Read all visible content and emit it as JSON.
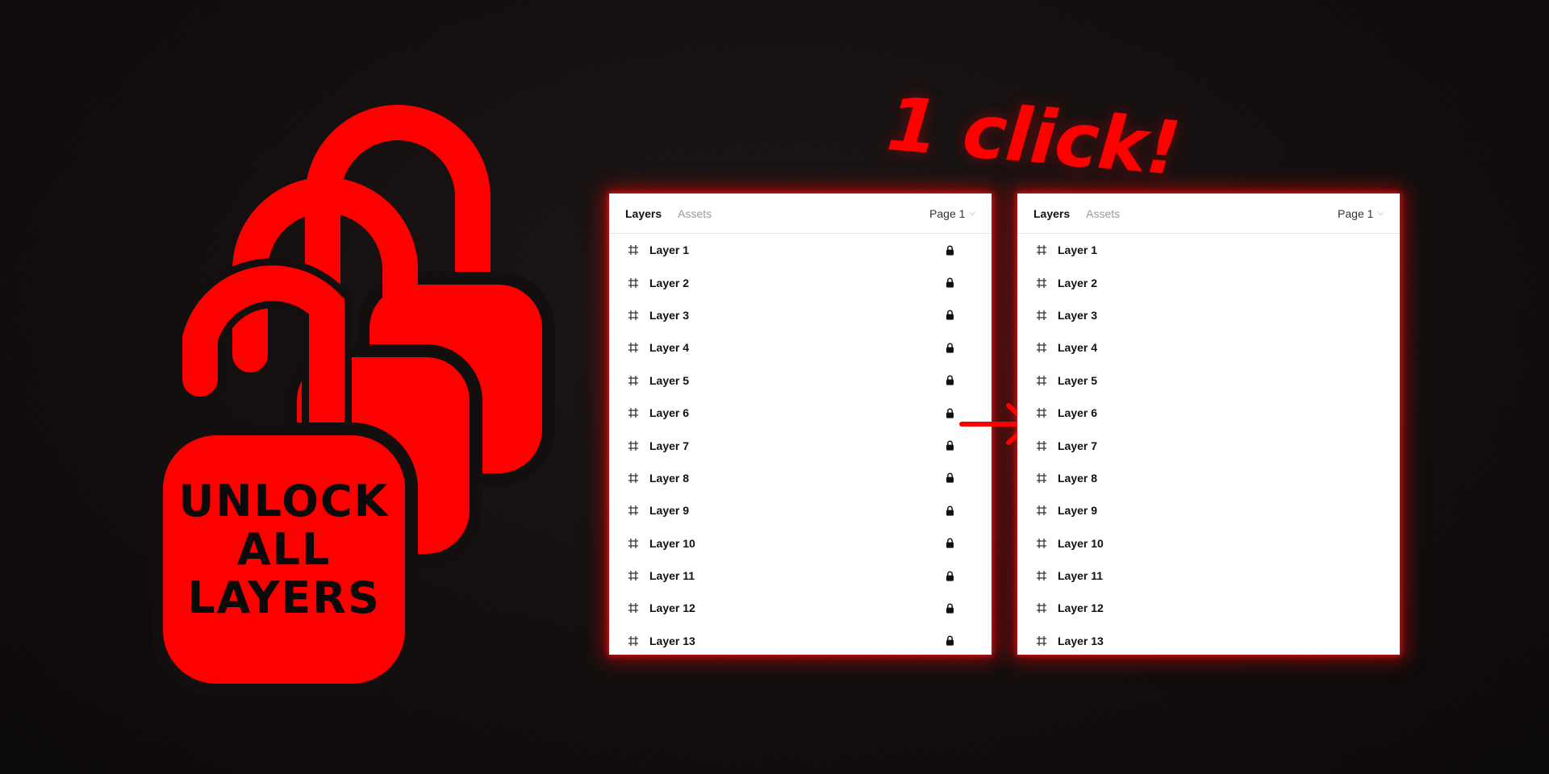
{
  "hero": {
    "lines": [
      "UNLOCK",
      "ALL",
      "LAYERS"
    ],
    "icon": "open-padlock-icon",
    "color": "#ff0000"
  },
  "headline": "1 click!",
  "panels": {
    "tabs": {
      "layers": "Layers",
      "assets": "Assets"
    },
    "page_select": "Page 1",
    "layers": [
      "Layer 1",
      "Layer 2",
      "Layer 3",
      "Layer 4",
      "Layer 5",
      "Layer 6",
      "Layer 7",
      "Layer 8",
      "Layer 9",
      "Layer 10",
      "Layer 11",
      "Layer 12",
      "Layer 13"
    ],
    "before": {
      "locked": true,
      "row_icon": "frame-icon",
      "status_icon": "lock-icon"
    },
    "after": {
      "locked": false,
      "row_icon": "frame-icon"
    }
  },
  "colors": {
    "accent": "#ff0000",
    "panel_bg": "#ffffff",
    "background": "#140f0f"
  },
  "arrow_icon": "arrow-right-icon"
}
